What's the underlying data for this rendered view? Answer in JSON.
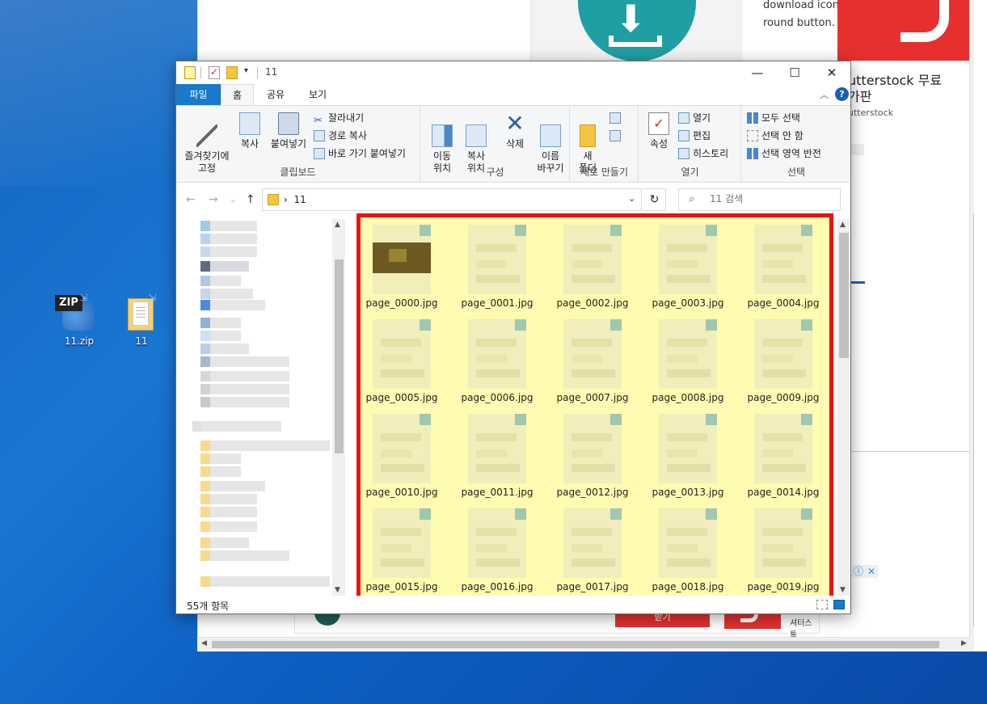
{
  "desktop": {
    "icons": [
      {
        "label": "11.zip",
        "badge": "ZIP"
      },
      {
        "label": "11"
      }
    ]
  },
  "browser": {
    "ad_description": "download icon. upload button. load symbol. round button. vector. arrow point to down",
    "side_title": "utterstock 무료\n가판",
    "side_sub": "utterstock",
    "bottom_logo_text": "셔터스톡",
    "bottom_button": "받기",
    "ad_info": "ⓘ",
    "ad_close": "✕"
  },
  "explorer": {
    "title": "11",
    "window_controls": {
      "minimize": "—",
      "maximize": "☐",
      "close": "✕"
    },
    "tabs": [
      "파일",
      "홈",
      "공유",
      "보기"
    ],
    "active_tab": "홈",
    "ribbon": {
      "clipboard": {
        "group_label": "클립보드",
        "pin": "즐겨찾기에\n고정",
        "copy": "복사",
        "paste": "붙여넣기",
        "cut": "잘라내기",
        "copy_path": "경로 복사",
        "paste_shortcut": "바로 가기 붙여넣기"
      },
      "organize": {
        "group_label": "구성",
        "move_to": "이동\n위치",
        "copy_to": "복사\n위치",
        "delete": "삭제",
        "rename": "이름\n바꾸기"
      },
      "new": {
        "group_label": "새로 만들기",
        "new_folder": "새\n폴더"
      },
      "open": {
        "group_label": "열기",
        "properties": "속성",
        "open": "열기",
        "edit": "편집",
        "history": "히스토리"
      },
      "select": {
        "group_label": "선택",
        "select_all": "모두 선택",
        "select_none": "선택 안 함",
        "invert": "선택 영역 반전"
      }
    },
    "address": {
      "path": "11",
      "search_placeholder": "11 검색"
    },
    "files": [
      "page_0000.jpg",
      "page_0001.jpg",
      "page_0002.jpg",
      "page_0003.jpg",
      "page_0004.jpg",
      "page_0005.jpg",
      "page_0006.jpg",
      "page_0007.jpg",
      "page_0008.jpg",
      "page_0009.jpg",
      "page_0010.jpg",
      "page_0011.jpg",
      "page_0012.jpg",
      "page_0013.jpg",
      "page_0014.jpg",
      "page_0015.jpg",
      "page_0016.jpg",
      "page_0017.jpg",
      "page_0018.jpg",
      "page_0019.jpg"
    ],
    "status": "55개 항목"
  },
  "colors": {
    "highlight_border": "#ef1010",
    "highlight_fill": "#fffbb0",
    "file_tab": "#1979ca"
  }
}
